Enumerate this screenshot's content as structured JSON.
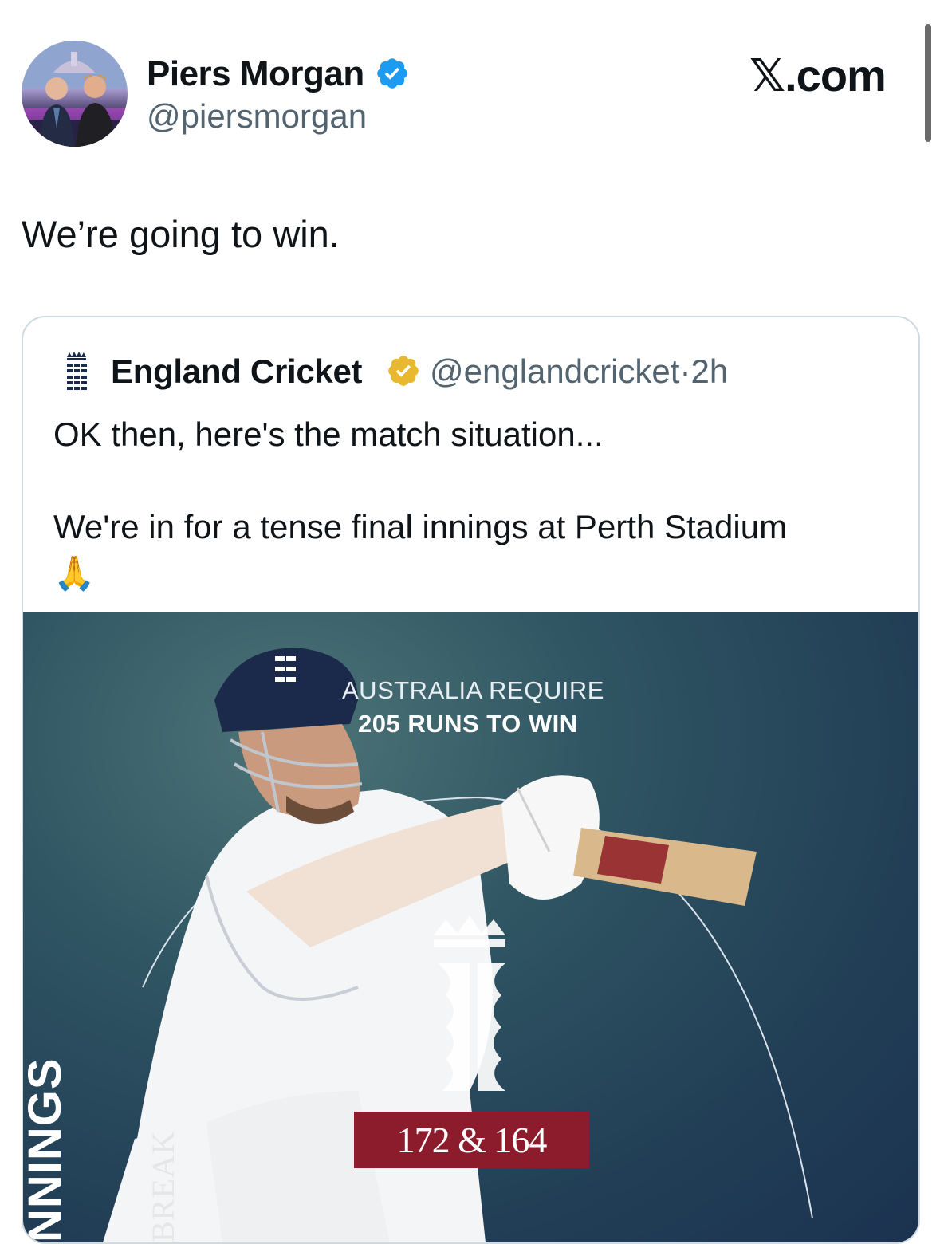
{
  "author": {
    "name": "Piers Morgan",
    "handle": "@piersmorgan",
    "verified_icon": "blue-verified-badge",
    "avatar": "profile-photo"
  },
  "brand": {
    "label": "𝕏.com"
  },
  "tweet": {
    "text": "We’re going to win."
  },
  "quoted": {
    "name": "England Cricket",
    "handle": "@englandcricket",
    "separator": "·",
    "time": "2h",
    "verified_icon": "gold-verified-badge",
    "line1": "OK then, here's the match situation...",
    "line2": "We're in for a tense final innings at Perth Stadium",
    "emoji": "🙏",
    "media": {
      "headline_line1": "AUSTRALIA REQUIRE",
      "headline_line2": "205 RUNS TO WIN",
      "score": "172 & 164",
      "side_label_big": "NNINGS",
      "side_label_small": "BREAK"
    }
  },
  "colors": {
    "verified_blue": "#1d9bf0",
    "verified_gold": "#e8b82e",
    "secondary_text": "#536471",
    "score_box": "#8c1c2c"
  }
}
